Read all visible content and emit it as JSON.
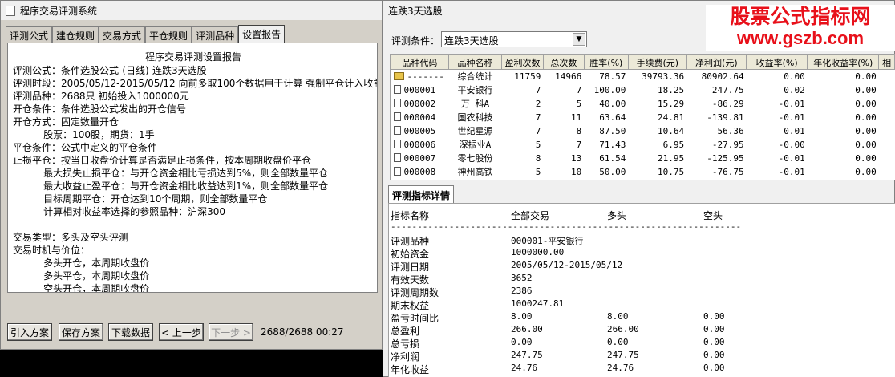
{
  "left_window": {
    "title": "程序交易评测系统",
    "tabs": [
      "评测公式",
      "建仓规则",
      "交易方式",
      "平仓规则",
      "评测品种",
      "设置报告"
    ],
    "active_tab": 5,
    "report_title": "程序交易评测设置报告",
    "report_lines": [
      "评测公式：条件选股公式-(日线)-连跌3天选股",
      "评测时段：2005/05/12-2015/05/12 向前多取100个数据用于计算 强制平仓计入收益",
      "评测品种：2688只 初始投入1000000元",
      "开仓条件：条件选股公式发出的开仓信号",
      "开仓方式：固定数量开仓",
      "          股票：100股，期货：1手",
      "平仓条件：公式中定义的平仓条件",
      "止损平仓：按当日收盘价计算是否满足止损条件，按本周期收盘价平仓",
      "          最大损失止损平仓：与开仓资金相比亏损达到5%，则全部数量平仓",
      "          最大收益止盈平仓：与开仓资金相比收益达到1%，则全部数量平仓",
      "          目标周期平仓：开仓达到10个周期，则全部数量平仓",
      "          计算相对收益率选择的参照品种：沪深300",
      "",
      "交易类型：多头及空头评测",
      "交易时机与价位：",
      "          多头开仓，本周期收盘价",
      "          多头平仓，本周期收盘价",
      "          空头开仓，本周期收盘价"
    ],
    "buttons": {
      "import": "引入方案",
      "save": "保存方案",
      "download": "下载数据",
      "prev": "< 上一步",
      "next": "下一步 >"
    },
    "status": "2688/2688 00:27"
  },
  "right_window": {
    "title": "连跌3天选股",
    "criteria_label": "评测条件：",
    "criteria_value": "连跌3天选股",
    "columns": [
      "品种代码",
      "品种名称",
      "盈利次数",
      "总次数",
      "胜率(%)",
      "手续费(元)",
      "净利润(元)",
      "收益率(%)",
      "年化收益率(%)",
      "相"
    ],
    "rows": [
      {
        "code": "-------",
        "name": "综合统计",
        "win": "11759",
        "total": "14966",
        "rate": "78.57",
        "fee": "39793.36",
        "profit": "80902.64",
        "ret": "0.00",
        "annual": "0.00"
      },
      {
        "code": "000001",
        "name": "平安银行",
        "win": "7",
        "total": "7",
        "rate": "100.00",
        "fee": "18.25",
        "profit": "247.75",
        "ret": "0.02",
        "annual": "0.00"
      },
      {
        "code": "000002",
        "name": "万  科A",
        "win": "2",
        "total": "5",
        "rate": "40.00",
        "fee": "15.29",
        "profit": "-86.29",
        "ret": "-0.01",
        "annual": "0.00"
      },
      {
        "code": "000004",
        "name": "国农科技",
        "win": "7",
        "total": "11",
        "rate": "63.64",
        "fee": "24.81",
        "profit": "-139.81",
        "ret": "-0.01",
        "annual": "0.00"
      },
      {
        "code": "000005",
        "name": "世纪星源",
        "win": "7",
        "total": "8",
        "rate": "87.50",
        "fee": "10.64",
        "profit": "56.36",
        "ret": "0.01",
        "annual": "0.00"
      },
      {
        "code": "000006",
        "name": "深振业A",
        "win": "5",
        "total": "7",
        "rate": "71.43",
        "fee": "6.95",
        "profit": "-27.95",
        "ret": "-0.00",
        "annual": "0.00"
      },
      {
        "code": "000007",
        "name": "零七股份",
        "win": "8",
        "total": "13",
        "rate": "61.54",
        "fee": "21.95",
        "profit": "-125.95",
        "ret": "-0.01",
        "annual": "0.00"
      },
      {
        "code": "000008",
        "name": "神州高铁",
        "win": "5",
        "total": "10",
        "rate": "50.00",
        "fee": "10.75",
        "profit": "-76.75",
        "ret": "-0.01",
        "annual": "0.00"
      }
    ],
    "detail_tab": "评测指标详情",
    "detail_headers": [
      "指标名称",
      "全部交易",
      "多头",
      "空头"
    ],
    "detail_separator": "------------------------------------------------------------------------------------------",
    "detail_rows": [
      {
        "name": "评测品种",
        "all": "000001-平安银行",
        "long": "",
        "short": ""
      },
      {
        "name": "初始资金",
        "all": "1000000.00",
        "long": "",
        "short": ""
      },
      {
        "name": "评测日期",
        "all": "2005/05/12-2015/05/12",
        "long": "",
        "short": ""
      },
      {
        "name": "有效天数",
        "all": "3652",
        "long": "",
        "short": ""
      },
      {
        "name": "评测周期数",
        "all": "2386",
        "long": "",
        "short": ""
      },
      {
        "name": "期末权益",
        "all": "1000247.81",
        "long": "",
        "short": ""
      },
      {
        "name": "盈亏时间比",
        "all": "8.00",
        "long": "8.00",
        "short": "0.00"
      },
      {
        "name": "总盈利",
        "all": "266.00",
        "long": "266.00",
        "short": "0.00"
      },
      {
        "name": "总亏损",
        "all": "0.00",
        "long": "0.00",
        "short": "0.00"
      },
      {
        "name": "净利润",
        "all": "247.75",
        "long": "247.75",
        "short": "0.00"
      },
      {
        "name": "年化收益",
        "all": "24.76",
        "long": "24.76",
        "short": "0.00"
      }
    ]
  },
  "watermark": {
    "line1": "股票公式指标网",
    "line2": "www.gszb.com",
    "color": "#e8101a"
  }
}
